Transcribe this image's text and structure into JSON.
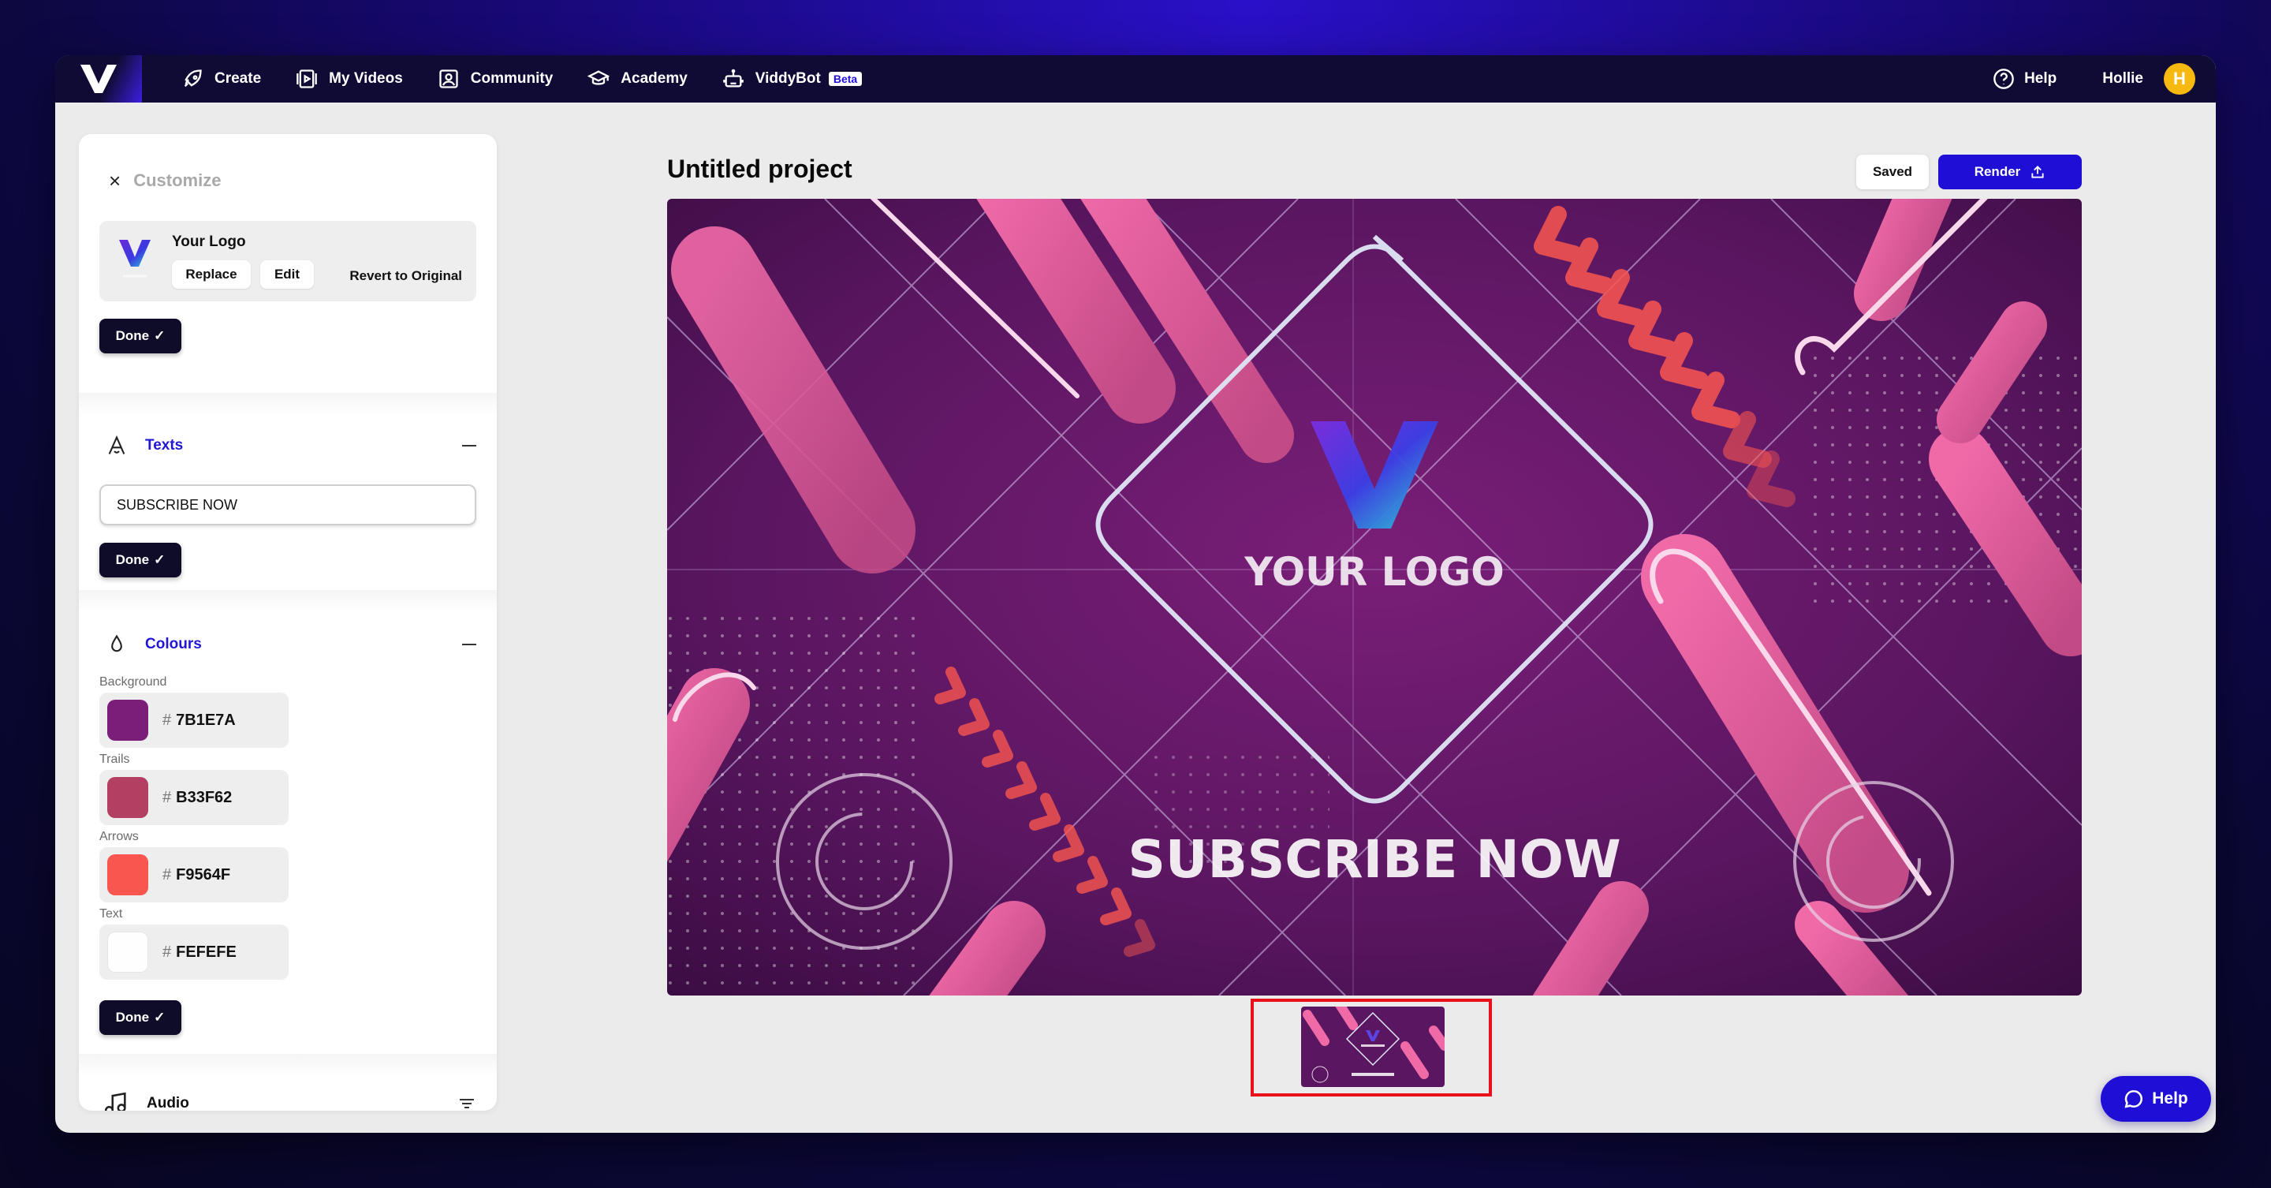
{
  "nav": {
    "items": [
      {
        "label": "Create",
        "icon": "rocket-icon"
      },
      {
        "label": "My Videos",
        "icon": "film-icon"
      },
      {
        "label": "Community",
        "icon": "community-icon"
      },
      {
        "label": "Academy",
        "icon": "graduation-cap-icon"
      },
      {
        "label": "ViddyBot",
        "icon": "robot-icon",
        "badge": "Beta"
      }
    ],
    "help_label": "Help",
    "user_name": "Hollie",
    "avatar_initial": "H",
    "avatar_color": "#F7B80F"
  },
  "panel": {
    "title": "Customize",
    "logo": {
      "name": "Your Logo",
      "replace_label": "Replace",
      "edit_label": "Edit",
      "revert_label": "Revert to Original",
      "done_label": "Done"
    },
    "texts": {
      "label": "Texts",
      "value": "SUBSCRIBE NOW",
      "done_label": "Done"
    },
    "colours": {
      "label": "Colours",
      "items": [
        {
          "label": "Background",
          "hex": "7B1E7A",
          "color": "#7B1E7A"
        },
        {
          "label": "Trails",
          "hex": "B33F62",
          "color": "#B33F62"
        },
        {
          "label": "Arrows",
          "hex": "F9564F",
          "color": "#F9564F"
        },
        {
          "label": "Text",
          "hex": "FEFEFE",
          "color": "#FEFEFE"
        }
      ],
      "done_label": "Done"
    },
    "audio": {
      "label": "Audio"
    }
  },
  "main": {
    "project_title": "Untitled project",
    "saved_label": "Saved",
    "render_label": "Render",
    "preview": {
      "logo_text": "YOUR LOGO",
      "headline": "SUBSCRIBE NOW"
    }
  },
  "float_help": {
    "label": "Help"
  },
  "colors": {
    "accent": "#1F0FD6",
    "nav_bg": "#100B35",
    "highlight": "#E8111B"
  }
}
